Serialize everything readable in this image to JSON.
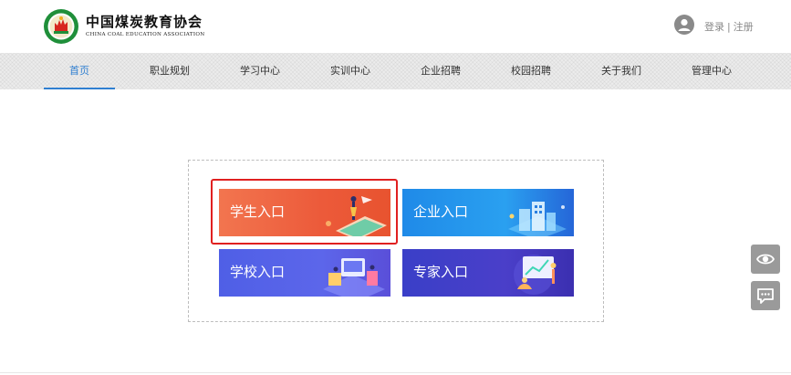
{
  "header": {
    "brand_cn": "中国煤炭教育协会",
    "brand_en": "CHINA COAL EDUCATION ASSOCIATION",
    "login_label": "登录",
    "separator": "|",
    "register_label": "注册",
    "logo_icon": "association-emblem-icon",
    "avatar_icon": "user-avatar-icon"
  },
  "nav": {
    "items": [
      {
        "label": "首页",
        "active": true
      },
      {
        "label": "职业规划",
        "active": false
      },
      {
        "label": "学习中心",
        "active": false
      },
      {
        "label": "实训中心",
        "active": false
      },
      {
        "label": "企业招聘",
        "active": false
      },
      {
        "label": "校园招聘",
        "active": false
      },
      {
        "label": "关于我们",
        "active": false
      },
      {
        "label": "管理中心",
        "active": false
      }
    ],
    "active_color": "#2f7fd1"
  },
  "entries": {
    "student": "学生入口",
    "company": "企业入口",
    "school": "学校入口",
    "expert": "专家入口"
  },
  "colors": {
    "student": "#ec5a3a",
    "company": "#2aa0f0",
    "school": "#5c66ea",
    "expert": "#4a3fc9",
    "highlight": "#e02020"
  },
  "floating": {
    "btn1_icon": "eye-icon",
    "btn2_icon": "chat-icon"
  }
}
